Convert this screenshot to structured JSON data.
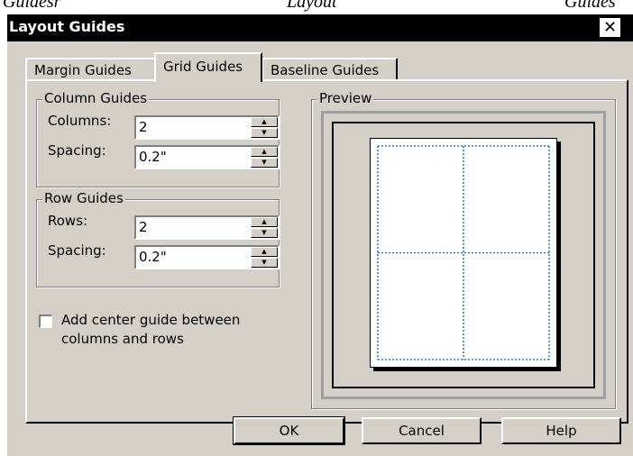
{
  "background_text": {
    "left": "Guidesr",
    "center": "Layout",
    "right": "Guides"
  },
  "dialog": {
    "title": "Layout Guides",
    "close_glyph": "✕"
  },
  "tabs": [
    {
      "label": "Margin Guides",
      "active": false
    },
    {
      "label": "Grid Guides",
      "active": true
    },
    {
      "label": "Baseline Guides",
      "active": false
    }
  ],
  "column_guides": {
    "group_label": "Column Guides",
    "columns_label": "Columns:",
    "columns_value": "2",
    "spacing_label": "Spacing:",
    "spacing_value": "0.2\""
  },
  "row_guides": {
    "group_label": "Row Guides",
    "rows_label": "Rows:",
    "rows_value": "2",
    "spacing_label": "Spacing:",
    "spacing_value": "0.2\""
  },
  "center_guide": {
    "label_line1": "Add center guide between",
    "label_line2": "columns and rows",
    "checked": false
  },
  "preview": {
    "group_label": "Preview",
    "grid_columns": 2,
    "grid_rows": 2,
    "guide_color": "#0066cc"
  },
  "buttons": {
    "ok": "OK",
    "cancel": "Cancel",
    "help": "Help"
  },
  "colors": {
    "dialog_face": "#d4d0c8",
    "titlebar": "#000000"
  }
}
